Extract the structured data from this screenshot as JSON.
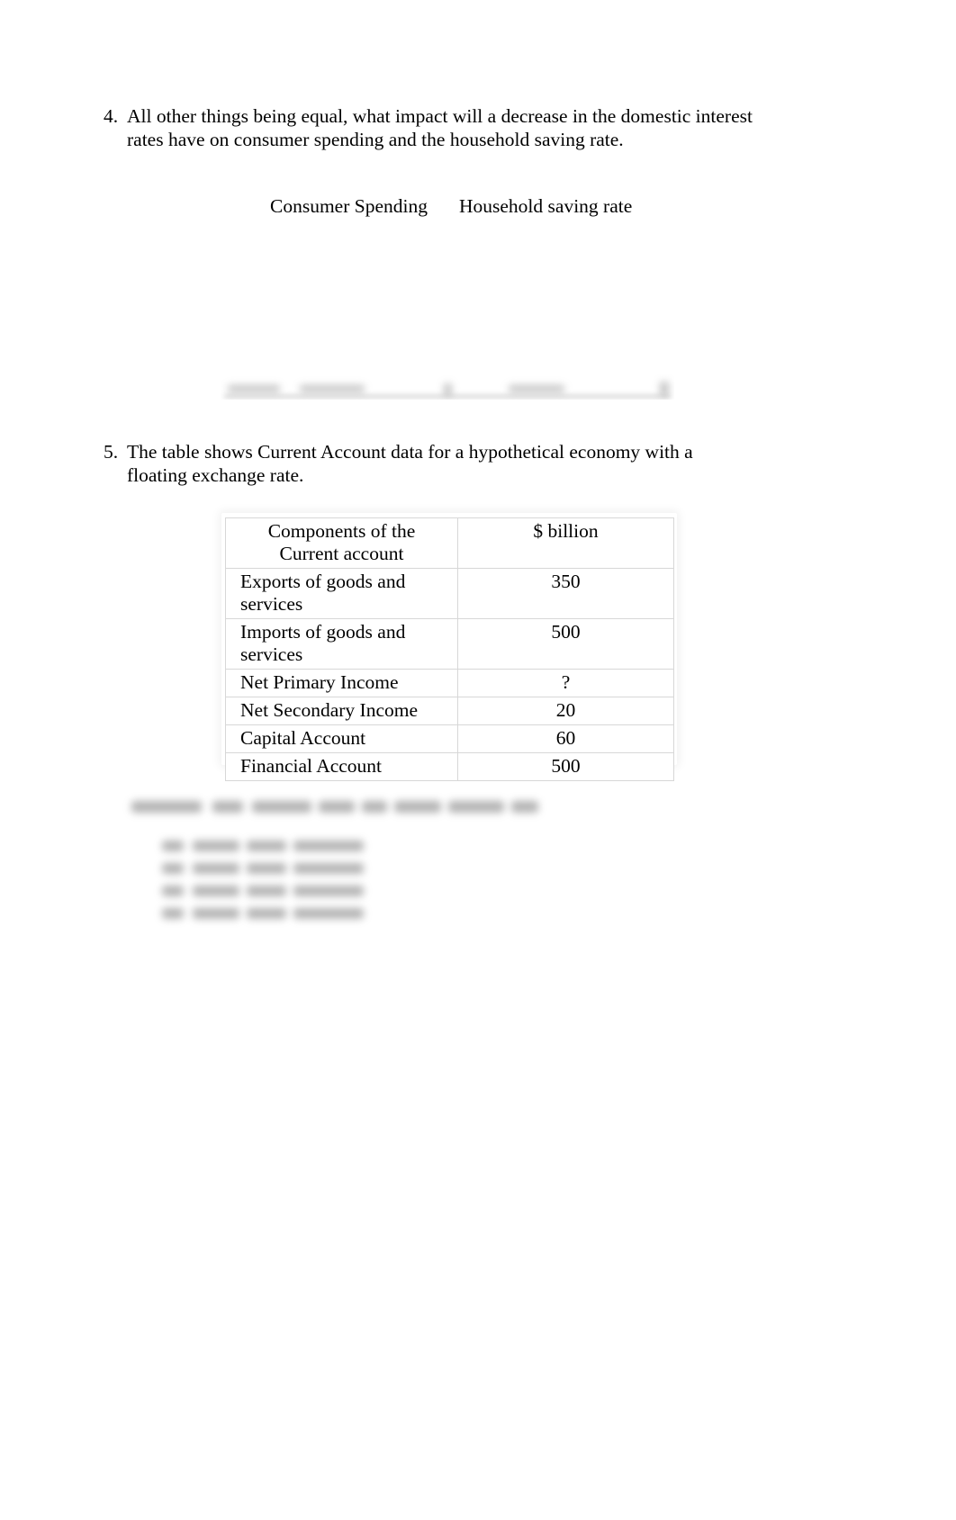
{
  "document": {
    "page_background": "#ffffff",
    "text_color": "#000000"
  },
  "question4": {
    "number": "4.",
    "text": "All other things being equal, what impact will a decrease in the domestic interest rates have on consumer spending and the household saving rate.",
    "column_headers": {
      "left": "Consumer Spending",
      "right": "Household saving rate"
    },
    "answer_area_note": "blurred answer option grid"
  },
  "question5": {
    "number": "5.",
    "text": "The table shows Current Account data for a hypothetical economy with a floating exchange rate.",
    "table": {
      "headers": [
        "Components of the Current account",
        "$ billion"
      ],
      "rows": [
        {
          "component": "Exports of goods and services",
          "value": "350"
        },
        {
          "component": "Imports of goods and services",
          "value": "500"
        },
        {
          "component": "Net Primary Income",
          "value": "?"
        },
        {
          "component": "Net Secondary Income",
          "value": "20"
        },
        {
          "component": "Capital Account",
          "value": "60"
        },
        {
          "component": "Financial Account",
          "value": "500"
        }
      ]
    },
    "prompt_note": "blurred question line",
    "options_note": "four blurred multiple-choice options"
  }
}
